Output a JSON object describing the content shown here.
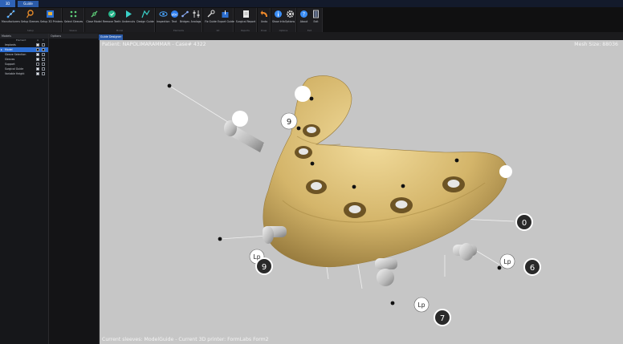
{
  "app": {
    "tab_label": "3D",
    "guide_tab": "Guide Designer"
  },
  "ribbon": {
    "groups": [
      {
        "label": "Setup",
        "buttons": [
          "Manufacturers",
          "Setup Sleeves",
          "Setup 3D Printers"
        ]
      },
      {
        "label": "Sleeve",
        "buttons": [
          "Select Sleeves"
        ]
      },
      {
        "label": "Model",
        "buttons": [
          "Close Model",
          "Remove Teeth",
          "Undercuts",
          "Design Guide"
        ]
      },
      {
        "label": "Elements",
        "buttons": [
          "Inspection",
          "Text",
          "Bridges",
          "Analogs"
        ]
      },
      {
        "label": "Kit",
        "buttons": [
          "Fix Guide",
          "Export Guide"
        ]
      },
      {
        "label": "Reports",
        "buttons": [
          "Surgical Report"
        ]
      },
      {
        "label": "Draw",
        "buttons": [
          "Undo"
        ]
      },
      {
        "label": "Options",
        "buttons": [
          "Show Info",
          "Options"
        ]
      },
      {
        "label": "Exit",
        "buttons": [
          "About",
          "Exit"
        ]
      }
    ]
  },
  "left_panel": {
    "title": "Models",
    "columns": {
      "name": "Element",
      "a": "A",
      "b": "T"
    },
    "rows": [
      {
        "label": "Implants",
        "a": true,
        "b": false,
        "selected": false
      },
      {
        "label": "Model",
        "a": false,
        "b": false,
        "selected": true
      },
      {
        "label": "Sleeve Selection",
        "a": true,
        "b": false,
        "selected": false
      },
      {
        "label": "Sleeves",
        "a": true,
        "b": false,
        "selected": false
      },
      {
        "label": "Support",
        "a": false,
        "b": false,
        "selected": false
      },
      {
        "label": "Surgical Guide",
        "a": true,
        "b": false,
        "selected": false
      },
      {
        "label": "Variable Height",
        "a": true,
        "b": false,
        "selected": false
      }
    ]
  },
  "options_panel": {
    "title": "Options"
  },
  "viewport": {
    "tab": "Guide Designer",
    "patient_info": "Patient: NAPOLIMARAMMAR - Case# 4322",
    "mesh_size": "Mesh Size: 88036",
    "status": "Current sleeves: ModelGuide - Current 3D printer: FormLabs Form2",
    "background_color": "#c6c6c6",
    "guide_color": "#d4b56a",
    "labels": {
      "nine_top": "9",
      "nine_bottom": "9",
      "zero": "0",
      "six": "6",
      "seven": "7",
      "lp": "Lp"
    }
  }
}
